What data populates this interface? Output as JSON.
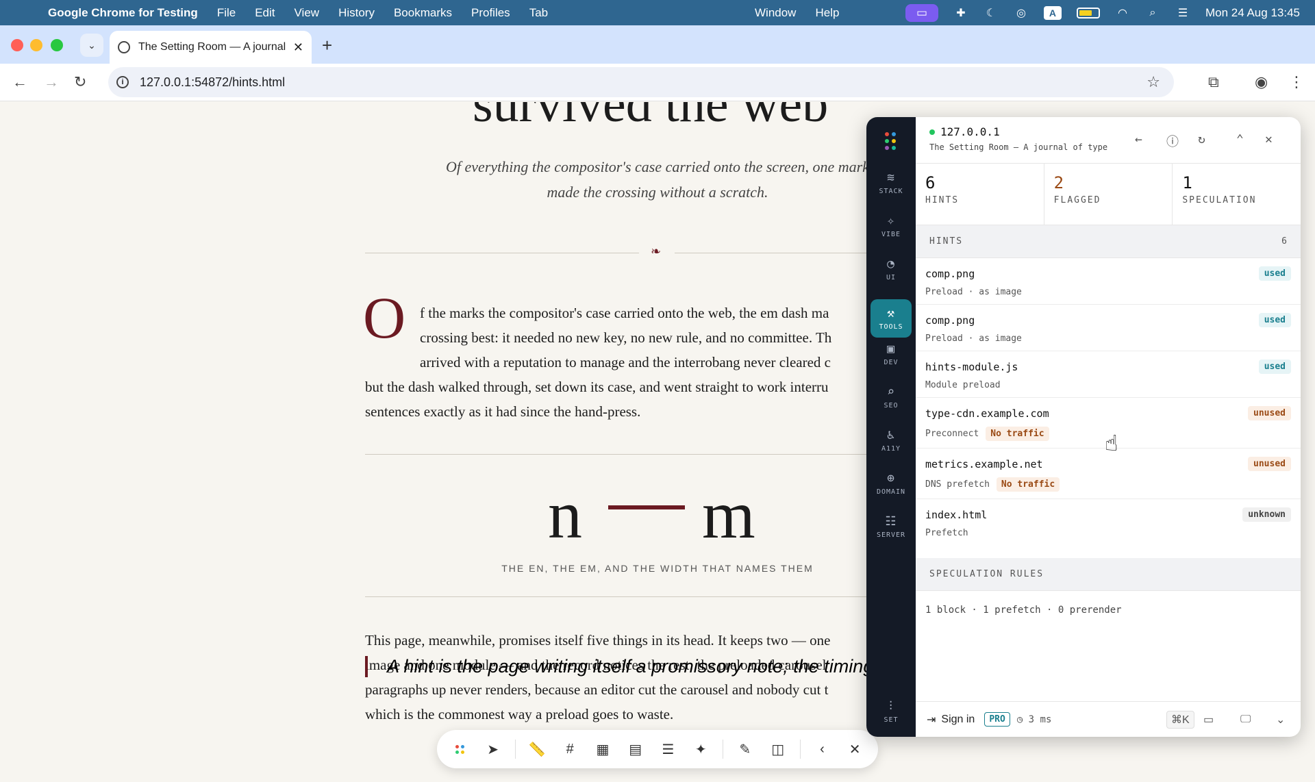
{
  "menubar": {
    "app_name": "Google Chrome for Testing",
    "items": [
      "File",
      "Edit",
      "View",
      "History",
      "Bookmarks",
      "Profiles",
      "Tab"
    ],
    "items_right": [
      "Window",
      "Help"
    ],
    "clock": "Mon 24 Aug  13:45"
  },
  "browser": {
    "tab_title": "The Setting Room — A journal of type",
    "url": "127.0.0.1:54872/hints.html"
  },
  "article": {
    "title_fragment": "survived the web",
    "subtitle": "Of everything the compositor's case carried onto the screen, one mark made the crossing without a scratch.",
    "fleuron": "❧",
    "dropcap": "O",
    "p1_lines": [
      "f the marks the compositor's case carried onto the web, the em dash ma",
      "crossing best: it needed no new key, no new rule, and no committee. Th",
      "arrived with a reputation to manage and the interrobang never cleared c",
      "but the dash walked through, set down its case, and went straight to work interru",
      "sentences exactly as it had since the hand-press."
    ],
    "glyph_n": "n",
    "glyph_m": "m",
    "figure_caption": "THE EN, THE EM, AND THE WIDTH THAT NAMES THEM",
    "p2_lines": [
      "This page, meanwhile, promises itself five things in its head. It keeps two — one",
      "image and one module — and the record notices the rest: the preloaded carousel",
      "paragraphs up never renders, because an editor cut the carousel and nobody cut t",
      "which is the commonest way a preload goes to waste."
    ],
    "quote": "A hint is the page writing itself a promissory note; the timing buffer is"
  },
  "panel": {
    "host": "127.0.0.1",
    "page_title": "The Setting Room — A journal of type",
    "rail": [
      "STACK",
      "VIBE",
      "UI",
      "TOOLS",
      "DEV",
      "SEO",
      "A11Y",
      "DOMAIN",
      "SERVER",
      "SET"
    ],
    "stats": [
      {
        "value": "6",
        "label": "HINTS"
      },
      {
        "value": "2",
        "label": "FLAGGED"
      },
      {
        "value": "1",
        "label": "SPECULATION"
      }
    ],
    "hints_header": "HINTS",
    "hints_count": "6",
    "hints": [
      {
        "name": "comp.png",
        "desc": "Preload · as image",
        "status": "used",
        "flag": ""
      },
      {
        "name": "comp.png",
        "desc": "Preload · as image",
        "status": "used",
        "flag": ""
      },
      {
        "name": "hints-module.js",
        "desc": "Module preload",
        "status": "used",
        "flag": ""
      },
      {
        "name": "type-cdn.example.com",
        "desc": "Preconnect",
        "status": "unused",
        "flag": "No traffic"
      },
      {
        "name": "metrics.example.net",
        "desc": "DNS prefetch",
        "status": "unused",
        "flag": "No traffic"
      },
      {
        "name": "index.html",
        "desc": "Prefetch",
        "status": "unknown",
        "flag": ""
      }
    ],
    "speculation_header": "SPECULATION RULES",
    "speculation_summary": "1 block · 1 prefetch · 0 prerender",
    "footer": {
      "signin": "Sign in",
      "pro": "PRO",
      "timing": "3 ms",
      "shortcut": "⌘K"
    }
  },
  "colors": {
    "accent": "#1a7f8e",
    "flag": "#9a4a15",
    "dash": "#6b1a22"
  }
}
